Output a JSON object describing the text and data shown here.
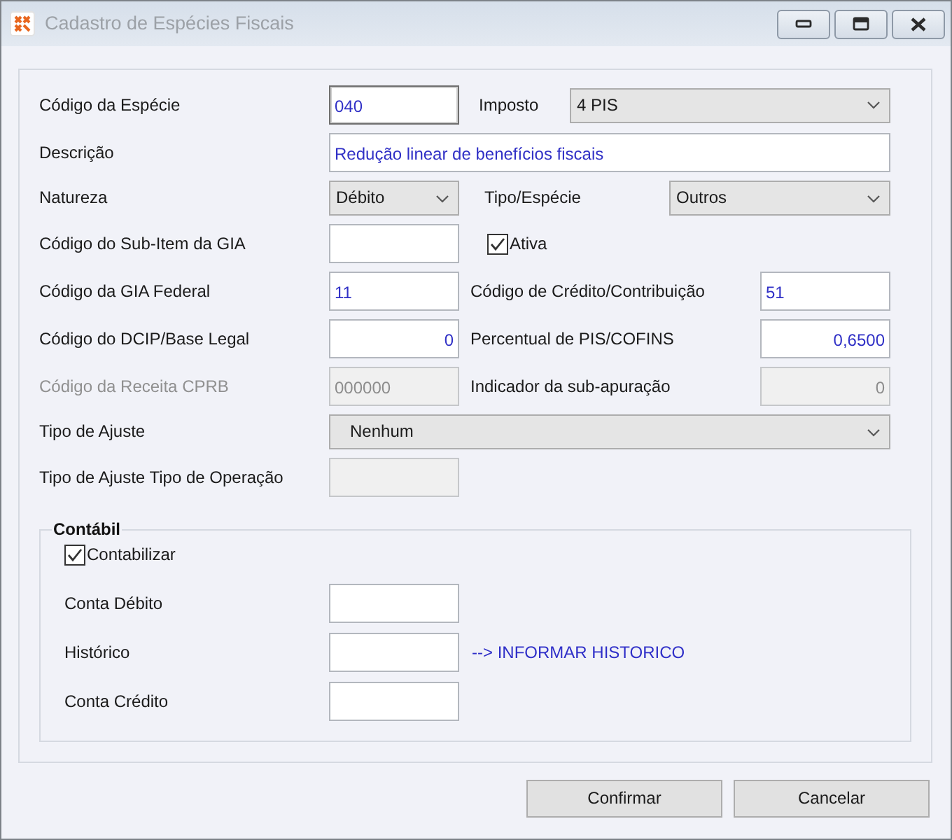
{
  "window": {
    "title": "Cadastro de Espécies Fiscais"
  },
  "form": {
    "rows": [
      {
        "items": [
          {
            "kind": "label",
            "text": "Código da Espécie",
            "disabled": false
          },
          {
            "kind": "input",
            "value": "040",
            "right_aligned": false,
            "disabled": false,
            "focused": true
          },
          {
            "kind": "label",
            "text": "Imposto",
            "disabled": false
          },
          {
            "kind": "select",
            "value": "4 PIS"
          }
        ]
      },
      {
        "items": [
          {
            "kind": "label",
            "text": "Descrição",
            "disabled": false
          },
          {
            "kind": "input",
            "value": "Redução linear de benefícios fiscais",
            "right_aligned": false,
            "disabled": false,
            "focused": false
          }
        ]
      },
      {
        "items": [
          {
            "kind": "label",
            "text": "Natureza",
            "disabled": false
          },
          {
            "kind": "select",
            "value": "Débito"
          },
          {
            "kind": "label",
            "text": "Tipo/Espécie",
            "disabled": false
          },
          {
            "kind": "select",
            "value": "Outros"
          }
        ]
      },
      {
        "items": [
          {
            "kind": "label",
            "text": "Código do Sub-Item da GIA",
            "disabled": false
          },
          {
            "kind": "input",
            "disabled": false,
            "focused": false
          },
          {
            "kind": "checkbox",
            "label": "Ativa",
            "checked": true
          }
        ]
      },
      {
        "items": [
          {
            "kind": "label",
            "text": "Código da GIA Federal",
            "disabled": false
          },
          {
            "kind": "input",
            "value": "11",
            "right_aligned": false,
            "disabled": false,
            "focused": false
          },
          {
            "kind": "label",
            "text": "Código de Crédito/Contribuição",
            "disabled": false
          },
          {
            "kind": "input",
            "value": "51",
            "right_aligned": false,
            "disabled": false,
            "focused": false
          }
        ]
      },
      {
        "items": [
          {
            "kind": "label",
            "text": "Código do DCIP/Base Legal",
            "disabled": false
          },
          {
            "kind": "input",
            "value": "0",
            "right_aligned": true,
            "disabled": false,
            "focused": false
          },
          {
            "kind": "label",
            "text": "Percentual de PIS/COFINS",
            "disabled": false
          },
          {
            "kind": "input",
            "value": "0,6500",
            "right_aligned": true,
            "disabled": false,
            "focused": false
          }
        ]
      },
      {
        "items": [
          {
            "kind": "label",
            "text": "Código da Receita CPRB",
            "disabled": true
          },
          {
            "kind": "input",
            "value": "000000",
            "right_aligned": false,
            "disabled": true,
            "focused": false
          },
          {
            "kind": "label",
            "text": "Indicador da sub-apuração",
            "disabled": false
          },
          {
            "kind": "input",
            "value": "0",
            "right_aligned": true,
            "disabled": true,
            "focused": false
          }
        ]
      },
      {
        "items": [
          {
            "kind": "label",
            "text": "Tipo de Ajuste",
            "disabled": false
          },
          {
            "kind": "select",
            "value": "Nenhum"
          }
        ]
      },
      {
        "items": [
          {
            "kind": "label",
            "text": "Tipo de Ajuste Tipo de Operação",
            "disabled": false
          },
          {
            "kind": "input",
            "disabled": true,
            "focused": false
          }
        ]
      }
    ]
  },
  "group": {
    "title": "Contábil",
    "rows": [
      {
        "items": [
          {
            "kind": "checkbox",
            "label": "Contabilizar",
            "checked": true
          }
        ]
      },
      {
        "items": [
          {
            "kind": "label",
            "text": "Conta Débito",
            "disabled": false
          },
          {
            "kind": "input",
            "disabled": false,
            "focused": false
          }
        ]
      },
      {
        "items": [
          {
            "kind": "label",
            "text": "Histórico",
            "disabled": false
          },
          {
            "kind": "input",
            "disabled": false,
            "focused": false
          },
          {
            "kind": "link",
            "text": "--> INFORMAR HISTORICO"
          }
        ]
      },
      {
        "items": [
          {
            "kind": "label",
            "text": "Conta Crédito",
            "disabled": false
          },
          {
            "kind": "input",
            "disabled": false,
            "focused": false
          }
        ]
      }
    ]
  },
  "buttons": [
    {
      "label": "Confirmar"
    },
    {
      "label": "Cancelar"
    }
  ]
}
